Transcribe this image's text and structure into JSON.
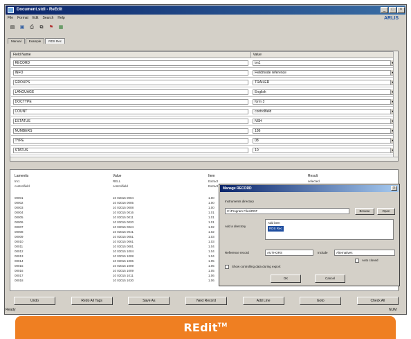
{
  "window": {
    "title": "Document.stdl - ReEdit",
    "logo": "ARLIS"
  },
  "menu": [
    "File",
    "Format",
    "Edit",
    "Search",
    "Help"
  ],
  "toolbar": [
    "open-icon",
    "save-icon",
    "print-icon",
    "copy-icon",
    "flag-icon",
    "image-icon"
  ],
  "tabs": [
    {
      "label": "Manual",
      "active": false
    },
    {
      "label": "Example",
      "active": false
    },
    {
      "label": "RDS Rec",
      "active": true
    }
  ],
  "grid": {
    "columns": [
      "Field Name",
      "Value"
    ],
    "rows": [
      {
        "name": "RECORD",
        "value": "tm1"
      },
      {
        "name": "INFO",
        "value": "Fieldmode reference"
      },
      {
        "name": "GROUPS",
        "value": "TRAILER"
      },
      {
        "name": "LANGUAGE",
        "value": "English"
      },
      {
        "name": "DOCTYPE",
        "value": "form 3"
      },
      {
        "name": "COUNT",
        "value": "controlfield"
      },
      {
        "name": "ESTATUS",
        "value": "NSH"
      },
      {
        "name": "NUMBERS",
        "value": "186"
      },
      {
        "name": "TYPE",
        "value": "08"
      },
      {
        "name": "STATUS",
        "value": "10"
      }
    ]
  },
  "lower": {
    "headers": [
      "Lamentis",
      "Value",
      "Item",
      "Result"
    ],
    "subrow1": [
      "tm1",
      "RELL",
      "Extract",
      "selected"
    ],
    "subrow2": [
      "controlfield",
      "controlfield",
      "Extract",
      "selected"
    ],
    "rows": [
      [
        "00001",
        "10 03015 0004"
      ],
      [
        "00002",
        "10 03016 0005"
      ],
      [
        "00003",
        "10 03015 0008"
      ],
      [
        "00004",
        "10 03015 0016"
      ],
      [
        "00005",
        "10 03015 0011"
      ],
      [
        "00006",
        "10 03015 0020"
      ],
      [
        "00007",
        "10 03015 0024"
      ],
      [
        "00008",
        "10 03015 0041"
      ],
      [
        "00009",
        "10 03015 0051"
      ],
      [
        "00010",
        "10 03015 0061"
      ],
      [
        "00011",
        "10 03015 0081"
      ],
      [
        "00012",
        "10 03015 1004"
      ],
      [
        "00013",
        "10 03015 1008"
      ],
      [
        "00014",
        "10 03015 1006"
      ],
      [
        "00015",
        "10 03015 1009"
      ],
      [
        "00016",
        "10 03015 1009"
      ],
      [
        "00017",
        "10 03015 1011"
      ],
      [
        "00018",
        "10 03015 1030"
      ]
    ],
    "third_col": [
      "1.00",
      "1.00",
      "1.00",
      "1.01",
      "1.01",
      "1.01",
      "1.02",
      "1.02",
      "1.03",
      "1.03",
      "1.04",
      "1.04",
      "1.04",
      "1.05",
      "1.05",
      "1.05",
      "1.06",
      "1.06"
    ]
  },
  "buttons": [
    "Undo",
    "Redo All Tags",
    "Save As",
    "Next Record",
    "Add Line",
    "Goto",
    "Check All"
  ],
  "status": {
    "left": "Ready",
    "right": "NUM"
  },
  "dialog": {
    "title": "Manage RECORD",
    "directory_label": "Instruments directory",
    "directory_value": "C:\\Program Files\\RDF",
    "browse_label": "Browse",
    "open_label": "Open",
    "selected_label": "Add a directory",
    "list_items": [
      "Add item",
      "RDS Rec"
    ],
    "reference_label": "Reference record",
    "reference_value": "AUTHORS",
    "include_label": "Include",
    "include_value": "Alternatives",
    "auto_label": "Auto closed",
    "checkbox_label": "Show controlling data during export",
    "ok_label": "OK",
    "cancel_label": "Cancel"
  },
  "banner": {
    "text": "REdit",
    "mark": "TM"
  }
}
